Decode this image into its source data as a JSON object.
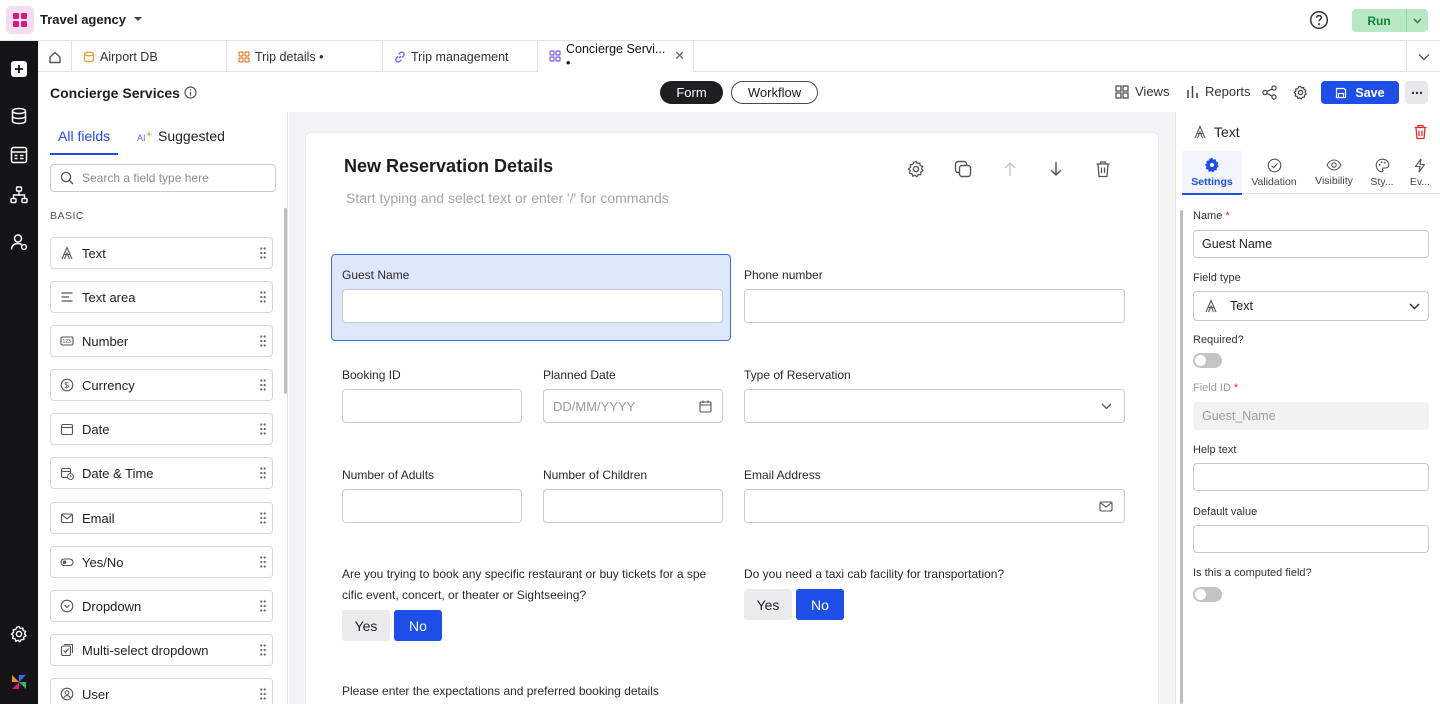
{
  "app": {
    "name": "Travel agency",
    "run_label": "Run"
  },
  "tabs": [
    {
      "label": "Airport DB"
    },
    {
      "label": "Trip details •"
    },
    {
      "label": "Trip management"
    },
    {
      "label": "Concierge Servi... •"
    }
  ],
  "header": {
    "title": "Concierge Services",
    "form_label": "Form",
    "workflow_label": "Workflow",
    "views_label": "Views",
    "reports_label": "Reports",
    "save_label": "Save"
  },
  "left_panel": {
    "tab_all": "All fields",
    "tab_suggested": "Suggested",
    "search_placeholder": "Search a field type here",
    "section_label": "BASIC",
    "fields": [
      {
        "label": "Text",
        "icon": "text-icon"
      },
      {
        "label": "Text area",
        "icon": "text-area-icon"
      },
      {
        "label": "Number",
        "icon": "number-icon"
      },
      {
        "label": "Currency",
        "icon": "currency-icon"
      },
      {
        "label": "Date",
        "icon": "date-icon"
      },
      {
        "label": "Date & Time",
        "icon": "date-time-icon"
      },
      {
        "label": "Email",
        "icon": "email-icon"
      },
      {
        "label": "Yes/No",
        "icon": "toggle-icon"
      },
      {
        "label": "Dropdown",
        "icon": "dropdown-icon"
      },
      {
        "label": "Multi-select dropdown",
        "icon": "multi-select-icon"
      },
      {
        "label": "User",
        "icon": "user-icon"
      }
    ]
  },
  "form": {
    "title": "New Reservation Details",
    "subtitle": "Start typing and select text or enter '/' for commands",
    "guest_name": "Guest Name",
    "phone_number": "Phone number",
    "booking_id": "Booking ID",
    "planned_date": "Planned Date",
    "planned_date_placeholder": "DD/MM/YYYY",
    "type_of_reservation": "Type of Reservation",
    "num_adults": "Number of Adults",
    "num_children": "Number of Children",
    "email_address": "Email Address",
    "question1_line1": "Are you trying to book any specific restaurant or buy tickets for a spe",
    "question1_line2": "cific event, concert, or theater or Sightseeing?",
    "question2": "Do you need a taxi cab facility for transportation?",
    "yes_label": "Yes",
    "no_label": "No",
    "expectations_label": "Please enter the expectations and preferred booking details"
  },
  "right_panel": {
    "title": "Text",
    "tabs": [
      "Settings",
      "Validation",
      "Visibility",
      "Sty...",
      "Ev..."
    ],
    "name_label": "Name",
    "name_value": "Guest Name",
    "field_type_label": "Field type",
    "field_type_value": "Text",
    "required_label": "Required?",
    "field_id_label": "Field ID",
    "field_id_value": "Guest_Name",
    "help_text_label": "Help text",
    "default_value_label": "Default value",
    "computed_label": "Is this a computed field?",
    "required_star": "*"
  },
  "colors": {
    "accent": "#1d4ee8",
    "run": "#b9e8c4",
    "selected_field": "#dde8fd",
    "danger": "#e52b2b"
  }
}
